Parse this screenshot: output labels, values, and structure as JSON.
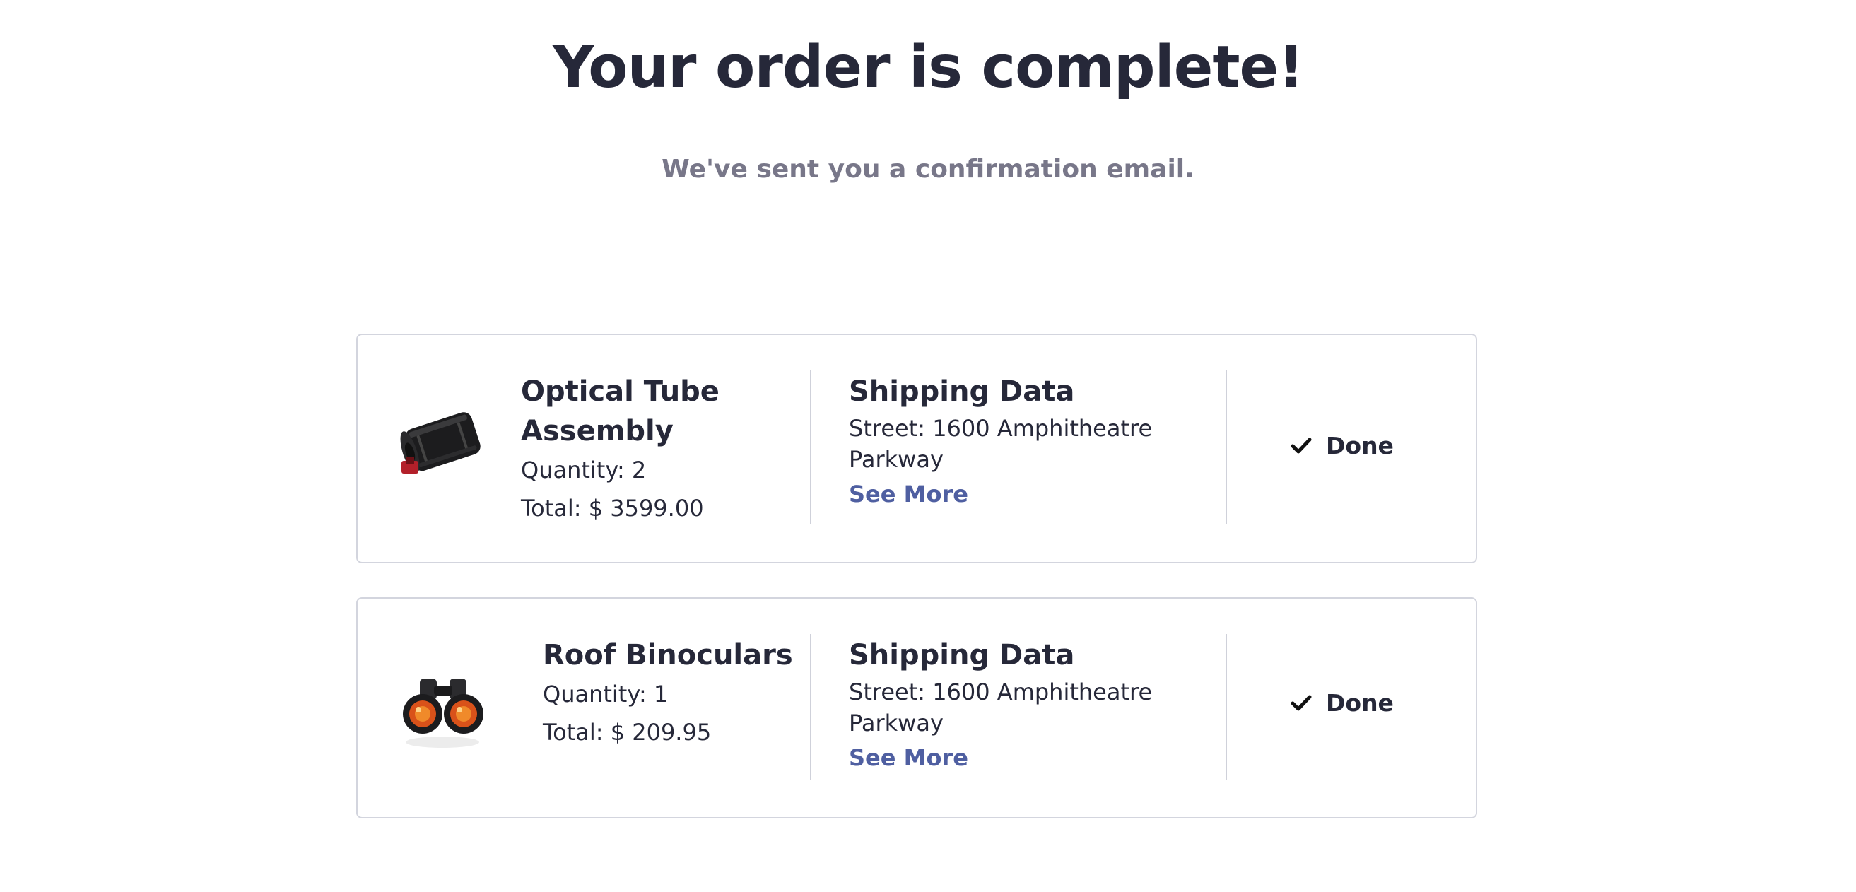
{
  "header": {
    "title": "Your order is complete!",
    "subtitle": "We've sent you a confirmation email."
  },
  "orders": [
    {
      "product_name": "Optical Tube Assembly",
      "quantity": "Quantity: 2",
      "total": "Total: $ 3599.00",
      "shipping_title": "Shipping Data",
      "street": "Street: 1600 Amphitheatre Parkway",
      "see_more_label": "See More",
      "status_label": "Done",
      "status_icon": "checkmark-icon",
      "thumbnail_icon": "telescope-tube-image"
    },
    {
      "product_name": "Roof Binoculars",
      "quantity": "Quantity: 1",
      "total": "Total: $ 209.95",
      "shipping_title": "Shipping Data",
      "street": "Street: 1600 Amphitheatre Parkway",
      "see_more_label": "See More",
      "status_label": "Done",
      "status_icon": "checkmark-icon",
      "thumbnail_icon": "binoculars-image"
    }
  ],
  "colors": {
    "text_primary": "#262839",
    "text_muted": "#787789",
    "link": "#4f5fa1",
    "border": "#d3d5de"
  }
}
